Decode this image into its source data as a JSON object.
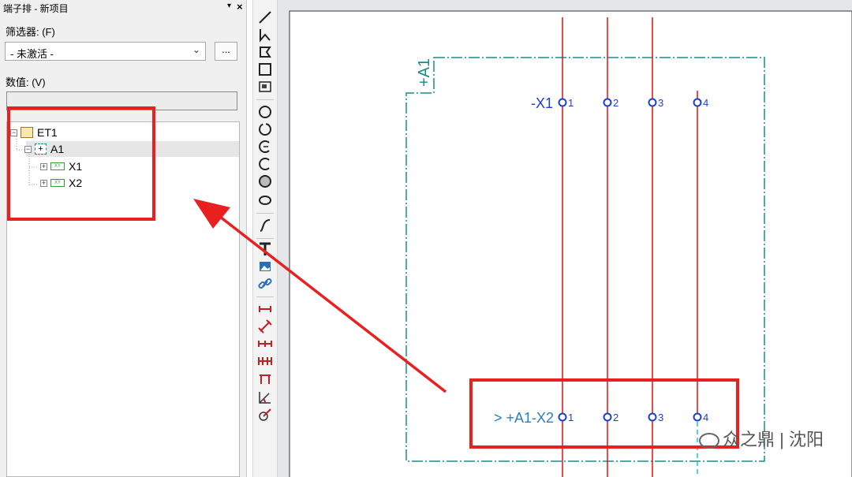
{
  "panel": {
    "title": "端子排 - 新项目",
    "pin_glyph": "▾",
    "close_glyph": "×",
    "filter_label": "筛选器: (F)",
    "filter_value": "- 未激活 -",
    "more_label": "...",
    "value_label": "数值: (V)",
    "value": ""
  },
  "tree": {
    "root": "ET1",
    "child": "A1",
    "items": [
      "X1",
      "X2"
    ],
    "tag_icon_text": "XY"
  },
  "schematic": {
    "location_label": "+A1",
    "top_strip_label": "-X1",
    "bottom_strip_label": "> +A1-X2",
    "terminals": [
      "1",
      "2",
      "3",
      "4"
    ]
  },
  "colors": {
    "wire": "#e01010",
    "frame": "#1a8a8a",
    "strip_label": "#1c3fd0",
    "bottom_label": "#2a7fbf",
    "highlight": "#e82020"
  },
  "watermark": "众之鼎 | 沈阳",
  "toolbar_icons": [
    "line-icon",
    "polyline-icon",
    "polygon-icon",
    "rectangle-icon",
    "rounded-rectangle-icon",
    "circle-icon",
    "circle-3point-icon",
    "arc-icon",
    "arc-3point-icon",
    "sector-icon",
    "ellipse-icon",
    "spline-icon",
    "text-icon",
    "image-icon",
    "hyperlink-icon",
    "dimension-linear-icon",
    "dimension-aligned-icon",
    "dimension-continuous-icon",
    "dimension-baseline-icon",
    "dimension-incremental-icon",
    "dimension-angle-icon",
    "dimension-radius-icon"
  ]
}
